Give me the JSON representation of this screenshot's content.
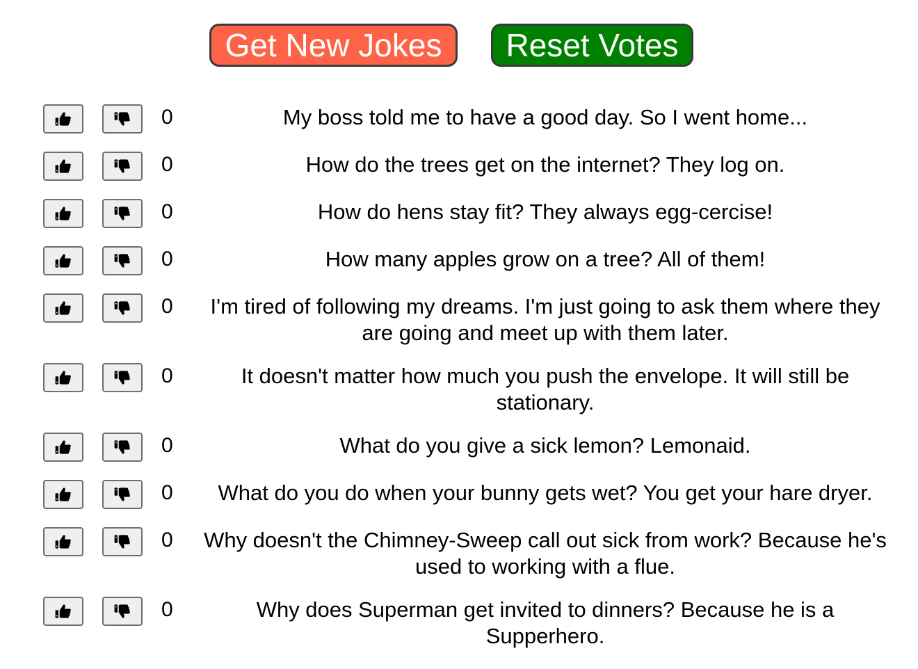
{
  "actions": {
    "get_new_jokes": {
      "label": "Get New Jokes",
      "bg": "#FF6347"
    },
    "reset_votes": {
      "label": "Reset Votes",
      "bg": "#008000"
    }
  },
  "icons": {
    "upvote": "thumbs-up-icon",
    "downvote": "thumbs-down-icon"
  },
  "jokes": [
    {
      "votes": "0",
      "text": "My boss told me to have a good day. So I went home..."
    },
    {
      "votes": "0",
      "text": "How do the trees get on the internet? They log on."
    },
    {
      "votes": "0",
      "text": "How do hens stay fit? They always egg-cercise!"
    },
    {
      "votes": "0",
      "text": "How many apples grow on a tree? All of them!"
    },
    {
      "votes": "0",
      "text": "I'm tired of following my dreams. I'm just going to ask them where they are going and meet up with them later."
    },
    {
      "votes": "0",
      "text": "It doesn't matter how much you push the envelope. It will still be stationary."
    },
    {
      "votes": "0",
      "text": "What do you give a sick lemon? Lemonaid."
    },
    {
      "votes": "0",
      "text": "What do you do when your bunny gets wet? You get your hare dryer."
    },
    {
      "votes": "0",
      "text": "Why doesn't the Chimney-Sweep call out sick from work? Because he's used to working with a flue."
    },
    {
      "votes": "0",
      "text": "Why does Superman get invited to dinners? Because he is a Supperhero."
    }
  ]
}
